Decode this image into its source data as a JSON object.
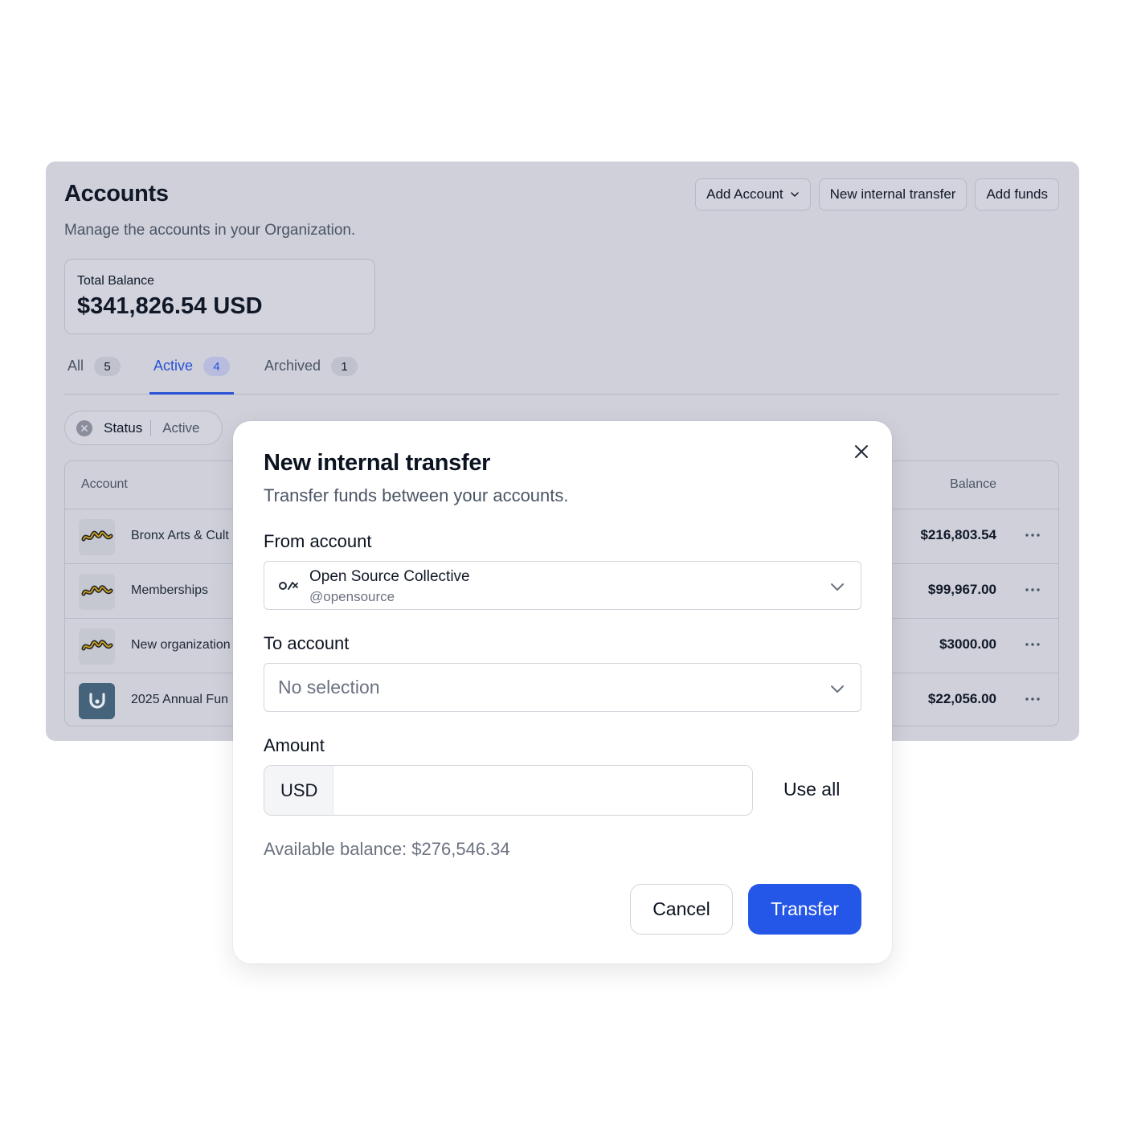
{
  "colors": {
    "accent": "#2457e8",
    "active_tab": "#2a52d6",
    "overlay_panel": "#cfd0d9",
    "muted_text": "#6b7280"
  },
  "accounts_page": {
    "title": "Accounts",
    "subtitle": "Manage the accounts in your Organization.",
    "actions": {
      "add_account": "Add Account",
      "new_internal_transfer": "New internal transfer",
      "add_funds": "Add funds"
    },
    "total_balance": {
      "label": "Total Balance",
      "value": "$341,826.54 USD"
    },
    "tabs": [
      {
        "label": "All",
        "count": "5",
        "active": false
      },
      {
        "label": "Active",
        "count": "4",
        "active": true
      },
      {
        "label": "Archived",
        "count": "1",
        "active": false
      }
    ],
    "filter": {
      "label": "Status",
      "value": "Active"
    },
    "table": {
      "columns": {
        "account": "Account",
        "balance": "Balance"
      },
      "rows": [
        {
          "name": "Bronx Arts & Cult",
          "balance": "$216,803.54",
          "avatar": "graffiti-logo"
        },
        {
          "name": "Memberships",
          "balance": "$99,967.00",
          "avatar": "graffiti-logo"
        },
        {
          "name": "New organization",
          "balance": "$3000.00",
          "avatar": "graffiti-logo"
        },
        {
          "name": "2025 Annual Fun",
          "balance": "$22,056.00",
          "avatar": "cup-logo"
        }
      ]
    }
  },
  "modal": {
    "title": "New internal transfer",
    "subtitle": "Transfer funds between your accounts.",
    "from_account": {
      "label": "From account",
      "name": "Open Source Collective",
      "handle": "@opensource",
      "icon": "open-collective-logo"
    },
    "to_account": {
      "label": "To account",
      "placeholder": "No selection"
    },
    "amount": {
      "label": "Amount",
      "currency": "USD",
      "value": "",
      "use_all": "Use all"
    },
    "available_balance": {
      "label": "Available balance:",
      "value": "$276,546.34"
    },
    "buttons": {
      "cancel": "Cancel",
      "transfer": "Transfer"
    }
  }
}
